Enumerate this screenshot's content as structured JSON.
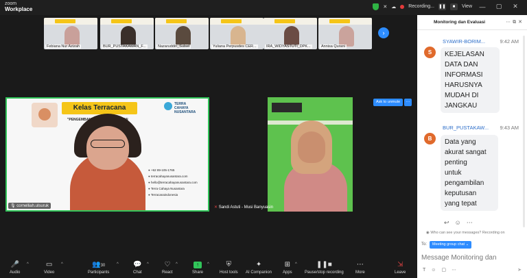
{
  "titlebar": {
    "logo_line1": "zoom",
    "logo_line2": "Workplace",
    "recording_label": "Recording...",
    "view_label": "View",
    "minimize": "—",
    "maximize": "▢",
    "close": "✕"
  },
  "participants_strip": [
    {
      "name": "Febiana Nur Azizah",
      "color": "#c9a09a"
    },
    {
      "name": "BUR_PUSTAKAWAN_F...",
      "color": "#3a2f2a"
    },
    {
      "name": "Nazaruddin_Sulsel",
      "color": "#5a4a3e"
    },
    {
      "name": "Yuliana Perpusdes CER...",
      "color": "#d8b58f"
    },
    {
      "name": "IRA_WIDYASTUTI_DPK...",
      "color": "#6b4c44"
    },
    {
      "name": "Annisa Qurani",
      "color": "#caa39c"
    }
  ],
  "speaker": {
    "name": "cornelliah.ulsuruk",
    "slide_title": "Kelas Terracana",
    "slide_subtitle": "\"PENGEMBANGAN PERPUSTAKAAN",
    "brand_line1": "TERRA",
    "brand_line2": "CAHAYA",
    "brand_line3": "NUSANTARA",
    "contacts": [
      "+62 89-105-1765",
      "terracahayanusantara.com",
      "hello@terracahayanusantara.com",
      "Terra Cahaya Nusantara",
      "Terracanaindonesia"
    ]
  },
  "second_video": {
    "name": "Sandi Astuti - Musi Banyuasin",
    "ask_to_unmute": "Ask to unmute",
    "more": "···"
  },
  "toolbar": {
    "audio": "Audio",
    "video": "Video",
    "participants": "Participants",
    "participants_count": "30",
    "chat": "Chat",
    "react": "React",
    "share": "Share",
    "host_tools": "Host tools",
    "ai_companion": "AI Companion",
    "apps": "Apps",
    "pause_recording": "Pause/stop recording",
    "more": "More",
    "leave": "Leave"
  },
  "chat": {
    "title": "Monitoring dan Evaluasi",
    "messages": [
      {
        "sender": "SYAWIR-BORIM...",
        "time": "9:42 AM",
        "avatar": "S",
        "lines": [
          "KEJELASAN",
          "DATA DAN",
          "INFORMASI",
          "HARUSNYA",
          "MUDAH DI",
          "JANGKAU"
        ]
      },
      {
        "sender": "BUR_PUSTAKAW...",
        "time": "9:43 AM",
        "avatar": "B",
        "lines": [
          "Data yang",
          "akurat sangat",
          "penting",
          "untuk",
          "pengambilan",
          "keputusan",
          "yang tepat"
        ]
      }
    ],
    "privacy_note": "Who can see your messages? Recording on",
    "to_label": "To:",
    "to_value": "Meeting group chat",
    "input_placeholder": "Message Monitoring dan"
  },
  "colors": {
    "accent": "#2d8cff",
    "speaker_border": "#31c55a",
    "avatar": "#e06a2c"
  }
}
